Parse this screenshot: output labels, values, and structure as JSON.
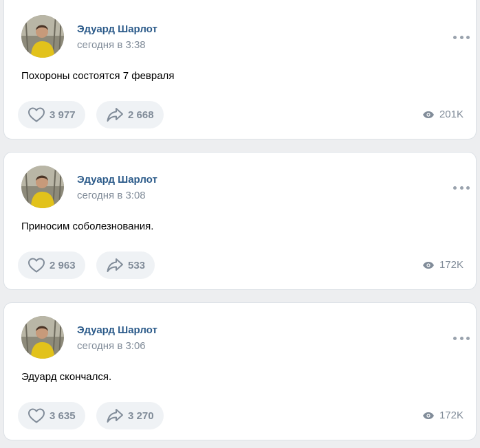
{
  "posts": [
    {
      "author": "Эдуард Шарлот",
      "time": "сегодня в 3:38",
      "text": "Похороны состоятся 7 февраля",
      "likes": "3 977",
      "shares": "2 668",
      "views": "201K"
    },
    {
      "author": "Эдуард Шарлот",
      "time": "сегодня в 3:08",
      "text": "Приносим соболезнования.",
      "likes": "2 963",
      "shares": "533",
      "views": "172K"
    },
    {
      "author": "Эдуард Шарлот",
      "time": "сегодня в 3:06",
      "text": "Эдуард скончался.",
      "likes": "3 635",
      "shares": "3 270",
      "views": "172K"
    }
  ],
  "icons": {
    "like": "heart-icon",
    "share": "share-arrow-icon",
    "views": "eye-icon",
    "more": "more-dots-icon"
  },
  "colors": {
    "author": "#2c5b8a",
    "secondary": "#818c99",
    "pill_bg": "#eff2f5",
    "page_bg": "#edeef0"
  }
}
